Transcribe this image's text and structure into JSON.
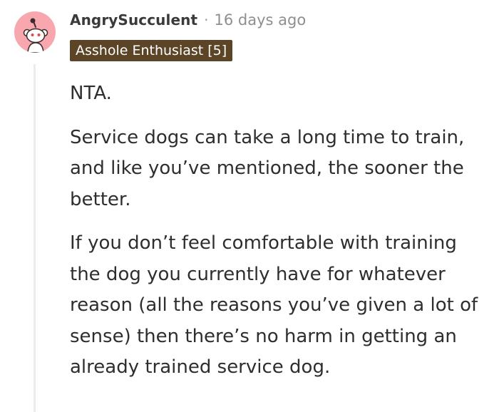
{
  "comment": {
    "author": "AngrySucculent",
    "separator": "·",
    "timestamp": "16 days ago",
    "flair": "Asshole Enthusiast [5]",
    "paragraphs": [
      "NTA.",
      "Service dogs can take a long time to train, and like you’ve mentioned, the sooner the better.",
      "If you don’t feel comfortable with training the dog you currently have for whatever reason (all the reasons you’ve given a lot of sense) then there’s no harm in getting an already trained service dog."
    ]
  },
  "colors": {
    "avatar_bg": "#f7a7ad",
    "flair_bg": "#5c4526",
    "thread_line": "#ececec"
  },
  "icons": {
    "avatar": "reddit-snoo-avatar-icon"
  }
}
